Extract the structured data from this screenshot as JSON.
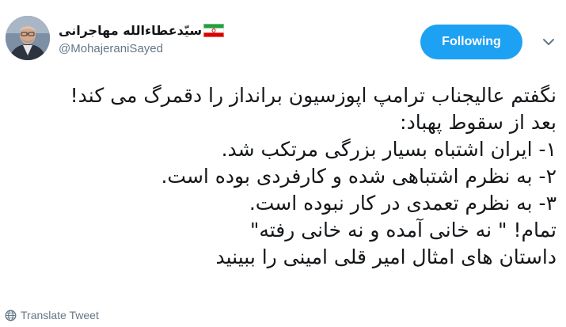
{
  "author": {
    "display_name": "سیّدعطاءالله مهاجرانی",
    "handle": "@MohajeraniSayed",
    "flag_icon": "iran-flag-icon"
  },
  "follow_button": {
    "label": "Following"
  },
  "tweet": {
    "lines": [
      "نگفتم عالیجناب ترامپ اپوزسیون برانداز را دقمرگ می کند!",
      "بعد از سقوط پهباد:",
      "۱- ایران اشتباه بسیار بزرگی مرتکب شد.",
      "۲- به نظرم اشتباهی شده و کارفردی بوده است.",
      "۳- به نظرم تعمدی در کار نبوده است.",
      "تمام! \" نه خانی آمده و نه خانی رفته\"",
      "داستان های امثال امیر قلی امینی را ببینید"
    ]
  },
  "translate": {
    "label": "Translate Tweet",
    "icon": "globe-icon"
  },
  "colors": {
    "accent": "#1da1f2",
    "secondary_text": "#657786",
    "primary_text": "#14171a"
  }
}
